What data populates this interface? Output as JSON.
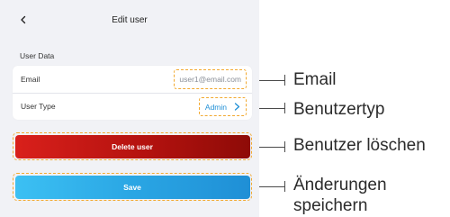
{
  "header": {
    "title": "Edit user",
    "back_icon": "chevron-left-icon"
  },
  "user_data": {
    "section_label": "User Data",
    "email": {
      "label": "Email",
      "value": "user1@email.com"
    },
    "user_type": {
      "label": "User Type",
      "value": "Admin",
      "icon": "chevron-right-icon"
    }
  },
  "buttons": {
    "delete_label": "Delete user",
    "save_label": "Save"
  },
  "annotations": {
    "email": "Email",
    "user_type": "Benutzertyp",
    "delete": "Benutzer löschen",
    "save_line1": "Änderungen",
    "save_line2": "speichern"
  },
  "colors": {
    "highlight": "#f2a930",
    "delete_button": "#b4120f",
    "save_button": "#2aa6e4",
    "link": "#1f8fd6",
    "panel_background": "#f1f2f6"
  }
}
